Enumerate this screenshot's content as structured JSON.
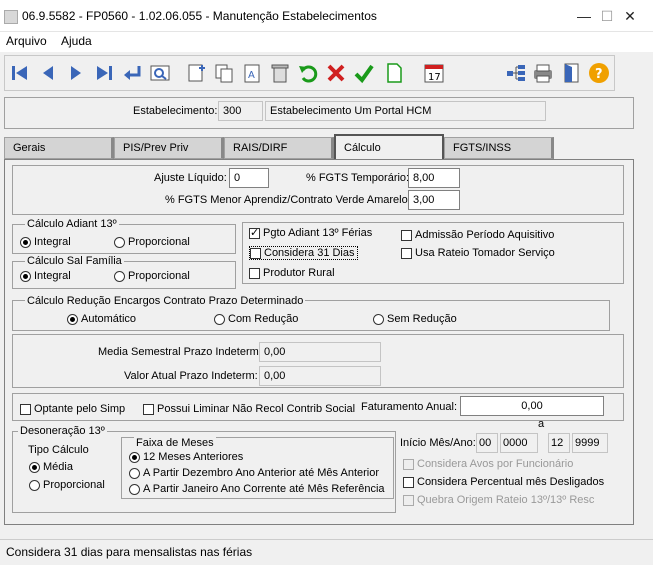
{
  "window": {
    "title": "06.9.5582 - FP0560 - 1.02.06.055 - Manutenção Estabelecimentos",
    "minimize": "—",
    "maximize": "☐",
    "close": "✕"
  },
  "menu": [
    "Arquivo",
    "Ajuda"
  ],
  "toolbar": {
    "calendar_day": "17"
  },
  "estabelecimento": {
    "label": "Estabelecimento:",
    "code": "300",
    "name": "Estabelecimento Um Portal HCM"
  },
  "tabs": [
    "Gerais",
    "PIS/Prev Priv",
    "RAIS/DIRF",
    "Cálculo",
    "FGTS/INSS"
  ],
  "active_tab": "Cálculo",
  "calc": {
    "ajuste_label": "Ajuste Líquido:",
    "ajuste_value": "0",
    "fgts_temp_label": "% FGTS Temporário:",
    "fgts_temp_value": "8,00",
    "fgts_menor_label": "% FGTS Menor Aprendiz/Contrato Verde Amarelo:",
    "fgts_menor_value": "3,00",
    "adiant": {
      "title": "Cálculo Adiant 13º",
      "opt1": "Integral",
      "opt2": "Proporcional",
      "selected": "Integral"
    },
    "salfam": {
      "title": "Cálculo Sal Família",
      "opt1": "Integral",
      "opt2": "Proporcional",
      "selected": "Integral"
    },
    "checks": {
      "pgto_adiant": {
        "label": "Pgto Adiant 13º Férias",
        "checked": true
      },
      "considera31": {
        "label": "Considera 31 Dias",
        "checked": false
      },
      "produtor": {
        "label": "Produtor Rural",
        "checked": false
      },
      "admissao": {
        "label": "Admissão Período Aquisitivo",
        "checked": false
      },
      "rateio": {
        "label": "Usa Rateio Tomador Serviço",
        "checked": false
      }
    },
    "reducao": {
      "title": "Cálculo Redução Encargos Contrato Prazo Determinado",
      "opt1": "Automático",
      "opt2": "Com Redução",
      "opt3": "Sem Redução",
      "selected": "Automático"
    },
    "media_label": "Media Semestral Prazo Indeterm:",
    "media_value": "0,00",
    "valor_label": "Valor Atual Prazo Indeterm:",
    "valor_value": "0,00",
    "optante": {
      "label": "Optante pelo Simp",
      "checked": false
    },
    "liminar": {
      "label": "Possui Liminar Não Recol Contrib Social",
      "checked": false
    },
    "faturamento_label": "Faturamento Anual:",
    "faturamento_value": "0,00",
    "deson": {
      "title": "Desoneração 13º",
      "tipo_label": "Tipo Cálculo",
      "opt1": "Média",
      "opt2": "Proporcional",
      "selected": "Média"
    },
    "faixa": {
      "title": "Faixa de Meses",
      "opt1": "12 Meses Anteriores",
      "opt2": "A Partir Dezembro Ano Anterior até Mês Anterior",
      "opt3": "A Partir Janeiro Ano Corrente até Mês Referência",
      "selected": "12 Meses Anteriores"
    },
    "inicio_label": "Início Mês/Ano:",
    "inicio_mes": "00",
    "inicio_ano": "0000",
    "a_label": "a",
    "fim_mes": "12",
    "fim_ano": "9999",
    "avos": {
      "label": "Considera Avos por Funcionário",
      "checked": false,
      "disabled": true
    },
    "percentual": {
      "label": "Considera Percentual mês Desligados",
      "checked": false
    },
    "quebra": {
      "label": "Quebra Origem Rateio 13º/13º Resc",
      "checked": false,
      "disabled": true
    }
  },
  "status": "Considera 31 dias para mensalistas nas férias",
  "colors": {
    "accent_green": "#1a9a1a",
    "accent_red": "#d02020",
    "toolbar_blue": "#3a66b8",
    "help_orange": "#f0a000"
  }
}
